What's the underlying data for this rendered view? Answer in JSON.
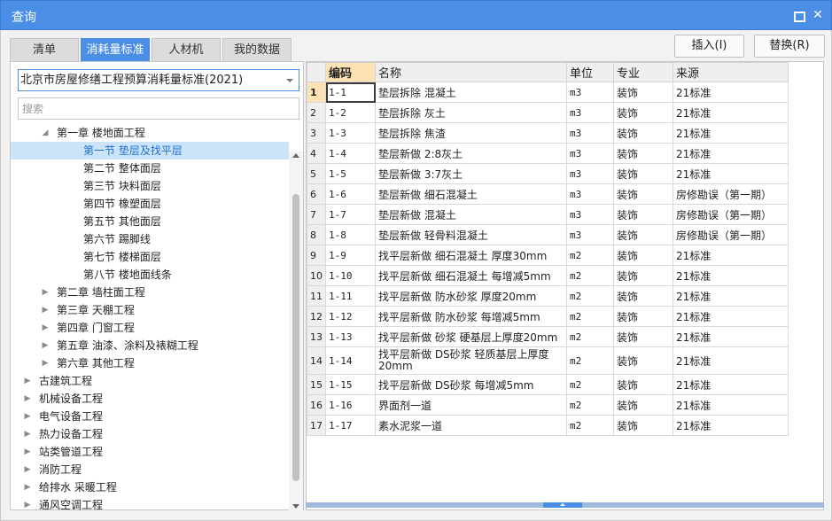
{
  "window": {
    "title": "查询"
  },
  "tabs": [
    "清单",
    "消耗量标准",
    "人材机",
    "我的数据"
  ],
  "actions": {
    "insert_label": "插入(I)",
    "replace_label": "替换(R)"
  },
  "left": {
    "selected_standard": "北京市房屋修缮工程预算消耗量标准(2021)",
    "search_placeholder": "搜索",
    "tree": [
      {
        "label": "第一章 楼地面工程",
        "level": 1,
        "state": "expanded"
      },
      {
        "label": "第一节 垫层及找平层",
        "level": 2,
        "state": "leaf",
        "selected": true
      },
      {
        "label": "第二节 整体面层",
        "level": 2,
        "state": "leaf"
      },
      {
        "label": "第三节 块料面层",
        "level": 2,
        "state": "leaf"
      },
      {
        "label": "第四节 橡塑面层",
        "level": 2,
        "state": "leaf"
      },
      {
        "label": "第五节 其他面层",
        "level": 2,
        "state": "leaf"
      },
      {
        "label": "第六节 踢脚线",
        "level": 2,
        "state": "leaf"
      },
      {
        "label": "第七节 楼梯面层",
        "level": 2,
        "state": "leaf"
      },
      {
        "label": "第八节 楼地面线条",
        "level": 2,
        "state": "leaf"
      },
      {
        "label": "第二章 墙柱面工程",
        "level": 1,
        "state": "collapsed"
      },
      {
        "label": "第三章 天棚工程",
        "level": 1,
        "state": "collapsed"
      },
      {
        "label": "第四章 门窗工程",
        "level": 1,
        "state": "collapsed"
      },
      {
        "label": "第五章 油漆、涂料及裱糊工程",
        "level": 1,
        "state": "collapsed"
      },
      {
        "label": "第六章 其他工程",
        "level": 1,
        "state": "collapsed"
      },
      {
        "label": "古建筑工程",
        "level": 0,
        "state": "collapsed"
      },
      {
        "label": "机械设备工程",
        "level": 0,
        "state": "collapsed"
      },
      {
        "label": "电气设备工程",
        "level": 0,
        "state": "collapsed"
      },
      {
        "label": "热力设备工程",
        "level": 0,
        "state": "collapsed"
      },
      {
        "label": "站类管道工程",
        "level": 0,
        "state": "collapsed"
      },
      {
        "label": "消防工程",
        "level": 0,
        "state": "collapsed"
      },
      {
        "label": "给排水 采暖工程",
        "level": 0,
        "state": "collapsed"
      },
      {
        "label": "通风空调工程",
        "level": 0,
        "state": "collapsed"
      }
    ]
  },
  "grid": {
    "headers": [
      "编码",
      "名称",
      "单位",
      "专业",
      "来源"
    ],
    "rows": [
      {
        "no": "1",
        "code": "1-1",
        "name": "垫层拆除 混凝土",
        "unit": "m3",
        "prof": "装饰",
        "src": "21标准"
      },
      {
        "no": "2",
        "code": "1-2",
        "name": "垫层拆除 灰土",
        "unit": "m3",
        "prof": "装饰",
        "src": "21标准"
      },
      {
        "no": "3",
        "code": "1-3",
        "name": "垫层拆除 焦渣",
        "unit": "m3",
        "prof": "装饰",
        "src": "21标准"
      },
      {
        "no": "4",
        "code": "1-4",
        "name": "垫层新做 2:8灰土",
        "unit": "m3",
        "prof": "装饰",
        "src": "21标准"
      },
      {
        "no": "5",
        "code": "1-5",
        "name": "垫层新做 3:7灰土",
        "unit": "m3",
        "prof": "装饰",
        "src": "21标准"
      },
      {
        "no": "6",
        "code": "1-6",
        "name": "垫层新做 细石混凝土",
        "unit": "m3",
        "prof": "装饰",
        "src": "房修勘误（第一期）"
      },
      {
        "no": "7",
        "code": "1-7",
        "name": "垫层新做 混凝土",
        "unit": "m3",
        "prof": "装饰",
        "src": "房修勘误（第一期）"
      },
      {
        "no": "8",
        "code": "1-8",
        "name": "垫层新做 轻骨料混凝土",
        "unit": "m3",
        "prof": "装饰",
        "src": "房修勘误（第一期）"
      },
      {
        "no": "9",
        "code": "1-9",
        "name": "找平层新做 细石混凝土 厚度30mm",
        "unit": "m2",
        "prof": "装饰",
        "src": "21标准"
      },
      {
        "no": "10",
        "code": "1-10",
        "name": "找平层新做 细石混凝土 每增减5mm",
        "unit": "m2",
        "prof": "装饰",
        "src": "21标准"
      },
      {
        "no": "11",
        "code": "1-11",
        "name": "找平层新做 防水砂浆 厚度20mm",
        "unit": "m2",
        "prof": "装饰",
        "src": "21标准"
      },
      {
        "no": "12",
        "code": "1-12",
        "name": "找平层新做 防水砂浆 每增减5mm",
        "unit": "m2",
        "prof": "装饰",
        "src": "21标准"
      },
      {
        "no": "13",
        "code": "1-13",
        "name": "找平层新做 砂浆 硬基层上厚度20mm",
        "unit": "m2",
        "prof": "装饰",
        "src": "21标准"
      },
      {
        "no": "14",
        "code": "1-14",
        "name": "找平层新做 DS砂浆 轻质基层上厚度20mm",
        "unit": "m2",
        "prof": "装饰",
        "src": "21标准",
        "tall": true
      },
      {
        "no": "15",
        "code": "1-15",
        "name": "找平层新做 DS砂浆 每增减5mm",
        "unit": "m2",
        "prof": "装饰",
        "src": "21标准"
      },
      {
        "no": "16",
        "code": "1-16",
        "name": "界面剂一道",
        "unit": "m2",
        "prof": "装饰",
        "src": "21标准"
      },
      {
        "no": "17",
        "code": "1-17",
        "name": "素水泥浆一道",
        "unit": "m2",
        "prof": "装饰",
        "src": "21标准"
      }
    ]
  }
}
